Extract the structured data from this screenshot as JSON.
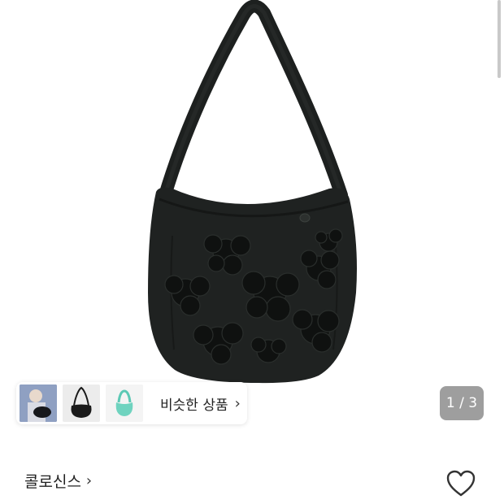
{
  "product": {
    "image_alt": "black quilted floral shoulder bag",
    "image_index": "1 / 3",
    "accent_colors": {
      "bag": "#1f2221",
      "bag_dark": "#111312",
      "counter_bg": "#9e9e9e"
    }
  },
  "similar": {
    "label": "비슷한 상품",
    "thumbnails": [
      "person-with-bag-thumbnail",
      "black-bag-thumbnail",
      "mint-bag-thumbnail"
    ]
  },
  "brand": {
    "name": "콜로신스"
  },
  "icons": {
    "like": "heart-icon",
    "chevron": "chevron-right-icon"
  }
}
